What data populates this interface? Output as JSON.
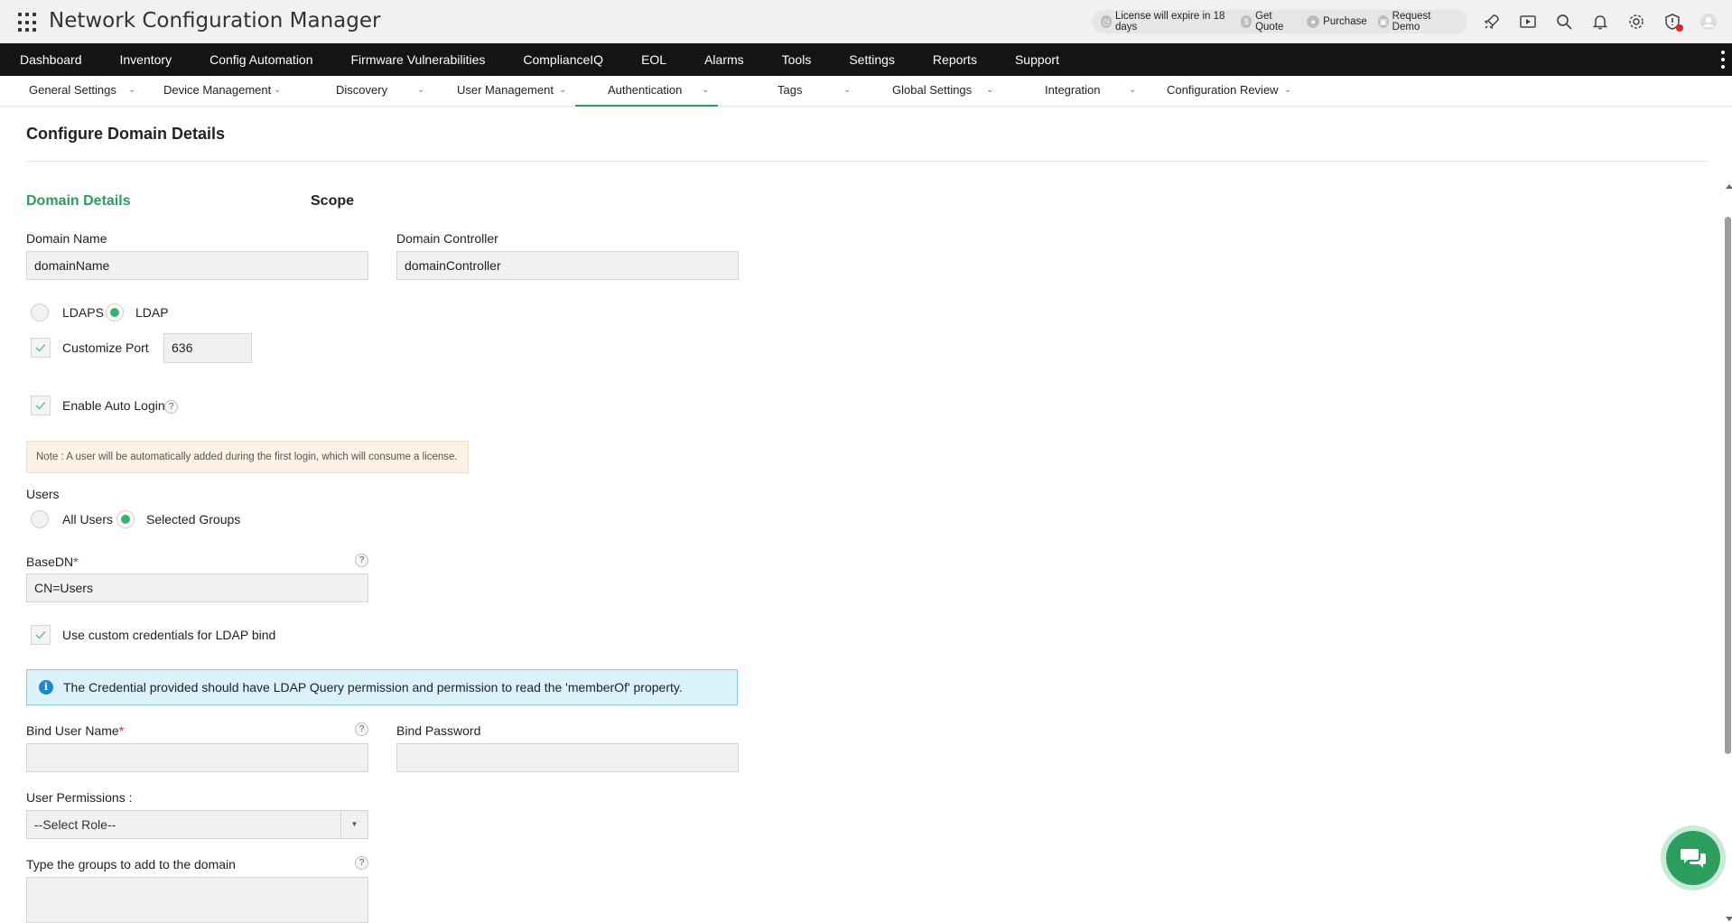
{
  "app": {
    "title": "Network Configuration Manager",
    "license_text": "License will expire in 18 days",
    "get_quote": "Get Quote",
    "purchase": "Purchase",
    "request_demo": "Request Demo",
    "icons": [
      "rocket-icon",
      "video-icon",
      "search-icon",
      "bell-icon",
      "gear-icon",
      "alert-icon",
      "user-icon"
    ]
  },
  "mainnav": {
    "items": [
      "Dashboard",
      "Inventory",
      "Config Automation",
      "Firmware Vulnerabilities",
      "ComplianceIQ",
      "EOL",
      "Alarms",
      "Tools",
      "Settings",
      "Reports",
      "Support"
    ]
  },
  "subnav": {
    "items": [
      "General Settings",
      "Device Management",
      "Discovery",
      "User Management",
      "Authentication",
      "Tags",
      "Global Settings",
      "Integration",
      "Configuration Review"
    ],
    "active": "Authentication"
  },
  "page": {
    "title": "Configure Domain Details",
    "tab_domain": "Domain Details",
    "tab_scope": "Scope"
  },
  "form": {
    "domain_name_label": "Domain Name",
    "domain_name_value": "domainName",
    "domain_controller_label": "Domain Controller",
    "domain_controller_value": "domainController",
    "ldaps_label": "LDAPS",
    "ldap_label": "LDAP",
    "protocol_selected": "LDAP",
    "customize_port_label": "Customize Port",
    "customize_port_checked": true,
    "port_value": "636",
    "auto_login_label": "Enable Auto Login",
    "auto_login_checked": true,
    "note": "Note : A user will be automatically added during the first login, which will consume a license.",
    "users_label": "Users",
    "all_users_label": "All Users",
    "selected_groups_label": "Selected Groups",
    "users_selected": "Selected Groups",
    "basedn_label": "BaseDN",
    "basedn_value": "CN=Users",
    "custom_cred_label": "Use custom credentials for LDAP bind",
    "custom_cred_checked": true,
    "info_text": "The Credential provided should have LDAP Query permission and permission to read the 'memberOf' property.",
    "bind_user_label": "Bind User Name",
    "bind_user_value": "",
    "bind_password_label": "Bind Password",
    "bind_password_value": "",
    "permissions_label": "User Permissions :",
    "role_selected": "--Select Role--",
    "groups_label": "Type the groups to add to the domain",
    "groups_value": "",
    "required_mark": "*",
    "help_mark": "?"
  },
  "colors": {
    "accent_green": "#2b9d5c",
    "nav_bg": "#141414",
    "info_bg": "#dcf2fb",
    "note_bg": "#fcf3e6"
  }
}
